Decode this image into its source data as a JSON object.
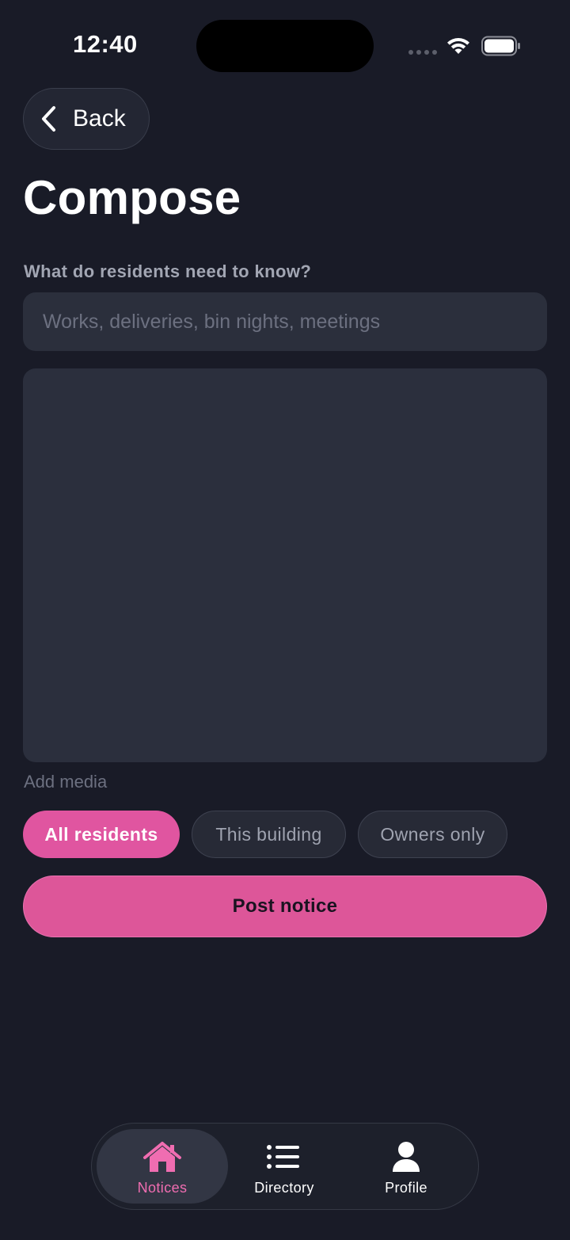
{
  "status_bar": {
    "time": "12:40"
  },
  "header": {
    "back_label": "Back",
    "title": "Compose"
  },
  "form": {
    "question_label": "What do residents need to know?",
    "title_placeholder": "Works, deliveries, bin nights, meetings",
    "title_value": "",
    "body_value": "",
    "add_media_label": "Add media"
  },
  "audience": {
    "options": [
      {
        "label": "All residents",
        "selected": true
      },
      {
        "label": "This building",
        "selected": false
      },
      {
        "label": "Owners only",
        "selected": false
      }
    ]
  },
  "actions": {
    "post_label": "Post notice"
  },
  "tab_bar": {
    "items": [
      {
        "label": "Notices",
        "icon": "house-icon",
        "active": true
      },
      {
        "label": "Directory",
        "icon": "list-icon",
        "active": false
      },
      {
        "label": "Profile",
        "icon": "person-icon",
        "active": false
      }
    ]
  },
  "colors": {
    "background": "#191b27",
    "accent": "#e055a0",
    "accent_text": "#f06db1",
    "field_bg": "#2b2f3c"
  }
}
